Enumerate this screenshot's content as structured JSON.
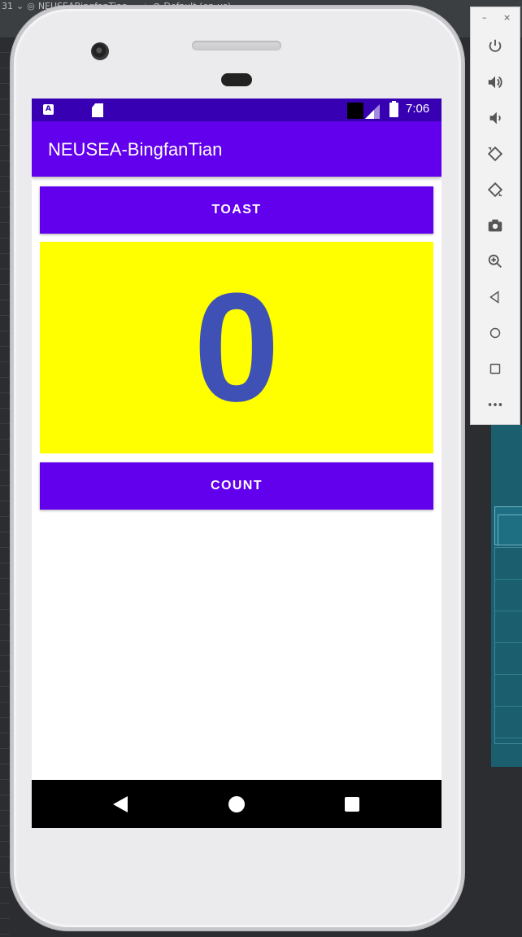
{
  "ide": {
    "line_number": "31",
    "project_name": "NEUSEABingfanTian",
    "locale": "Default (en-us)"
  },
  "status_bar": {
    "time": "7:06",
    "notif_icon_letter": "A"
  },
  "app": {
    "title": "NEUSEA-BingfanTian",
    "toast_button_label": "TOAST",
    "count_value": "0",
    "count_button_label": "COUNT"
  },
  "emulator_toolbar": {
    "window_minimize": "–",
    "window_close": "×"
  },
  "colors": {
    "primary": "#6200ee",
    "status_bar": "#3700b3",
    "counter_background": "#ffff00",
    "counter_text": "#3f51b5"
  }
}
